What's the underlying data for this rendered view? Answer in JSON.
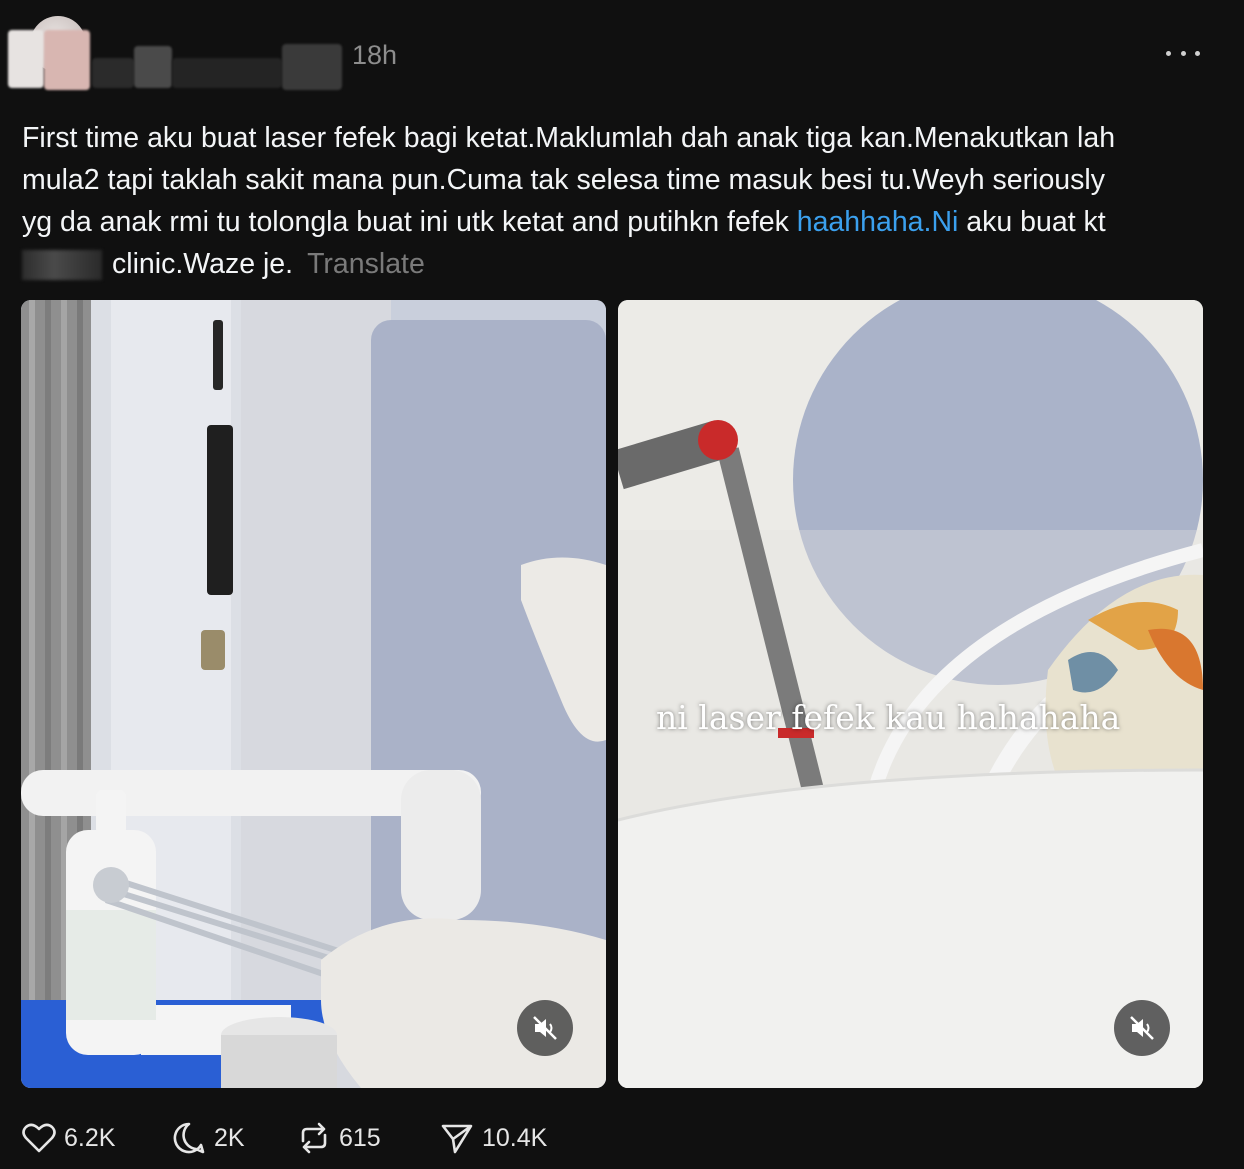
{
  "post": {
    "timestamp": "18h",
    "text_lines": [
      "First time aku buat laser fefek bagi ketat.Maklumlah dah anak tiga kan.Menakutkan lah",
      "mula2 tapi taklah sakit mana pun.Cuma tak selesa time masuk besi tu.Weyh seriously",
      "yg da anak rmi tu tolongla buat ini utk ketat and putihkn fefek "
    ],
    "hashtag_link": "haahhaha.Ni",
    "line3_tail": " aku buat kt",
    "line4_text": "clinic.Waze je.",
    "translate_label": "Translate",
    "media_overlay_text": "ni laser fefek kau hahahaha"
  },
  "actions": {
    "likes": "6.2K",
    "replies": "2K",
    "reposts": "615",
    "shares": "10.4K"
  },
  "icons": {
    "more": "more-icon",
    "mute": "volume-mute-icon",
    "like": "heart-icon",
    "reply": "comment-icon",
    "repost": "repost-icon",
    "share": "send-icon"
  },
  "colors": {
    "background": "#101010",
    "text": "#f3f5f7",
    "link": "#3ba0ee",
    "muted": "#7a7a7a"
  }
}
